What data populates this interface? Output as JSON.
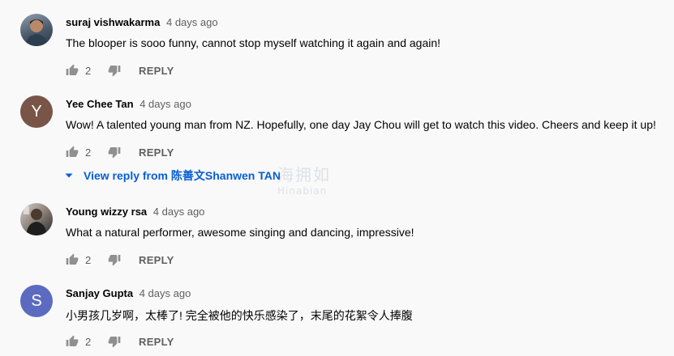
{
  "comments": [
    {
      "author": "suraj vishwakarma",
      "time": "4 days ago",
      "text": "The blooper is sooo funny, cannot stop myself watching it again and again!",
      "likes": "2",
      "reply_label": "REPLY",
      "avatar": {
        "type": "photo",
        "colors": [
          "#4a5a6a",
          "#8a9aa8"
        ]
      }
    },
    {
      "author": "Yee Chee Tan",
      "time": "4 days ago",
      "text": "Wow! A talented young man from NZ. Hopefully, one day Jay Chou will get to watch this video. Cheers and keep it up!",
      "likes": "2",
      "reply_label": "REPLY",
      "avatar": {
        "type": "letter",
        "letter": "Y",
        "color": "#795548"
      },
      "view_reply": "View reply from 陈善文Shanwen TAN"
    },
    {
      "author": "Young wizzy rsa",
      "time": "4 days ago",
      "text": "What a natural performer, awesome singing and dancing, impressive!",
      "likes": "2",
      "reply_label": "REPLY",
      "avatar": {
        "type": "photo",
        "colors": [
          "#3a3a3a",
          "#b8b0a8"
        ]
      }
    },
    {
      "author": "Sanjay Gupta",
      "time": "4 days ago",
      "text": "小男孩几岁啊，太棒了! 完全被他的快乐感染了，末尾的花絮令人捧腹",
      "likes": "2",
      "reply_label": "REPLY",
      "avatar": {
        "type": "letter",
        "letter": "S",
        "color": "#5c6bc0"
      }
    }
  ],
  "watermark": {
    "line1": "海拥如",
    "line2": "Hinabian"
  },
  "colors": {
    "link": "#065fd4",
    "muted": "#606060",
    "text": "#030303",
    "background": "#f9f9f9"
  }
}
